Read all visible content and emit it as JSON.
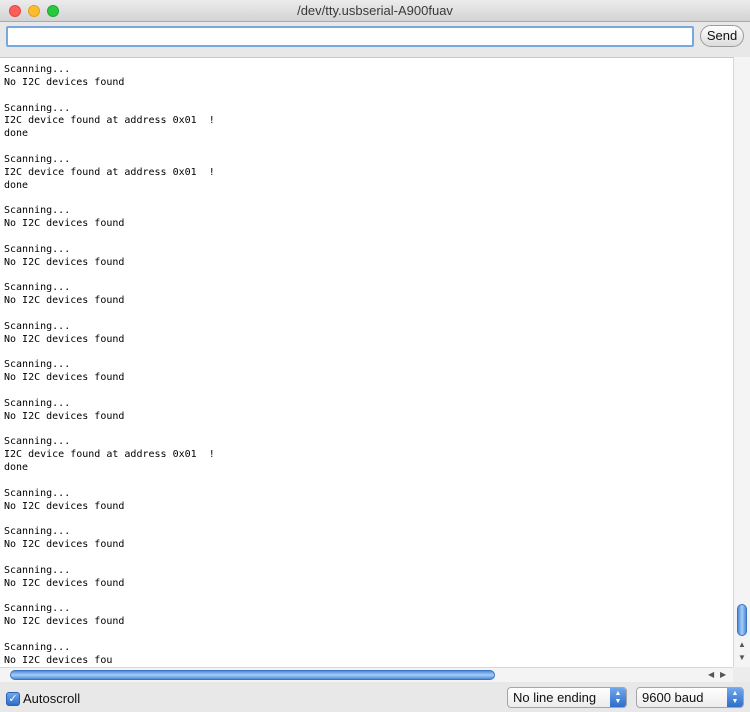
{
  "window": {
    "title": "/dev/tty.usbserial-A900fuav"
  },
  "toolbar": {
    "input_value": "",
    "send_label": "Send"
  },
  "console": {
    "lines": [
      "Scanning...",
      "No I2C devices found",
      "",
      "Scanning...",
      "I2C device found at address 0x01  !",
      "done",
      "",
      "Scanning...",
      "I2C device found at address 0x01  !",
      "done",
      "",
      "Scanning...",
      "No I2C devices found",
      "",
      "Scanning...",
      "No I2C devices found",
      "",
      "Scanning...",
      "No I2C devices found",
      "",
      "Scanning...",
      "No I2C devices found",
      "",
      "Scanning...",
      "No I2C devices found",
      "",
      "Scanning...",
      "No I2C devices found",
      "",
      "Scanning...",
      "I2C device found at address 0x01  !",
      "done",
      "",
      "Scanning...",
      "No I2C devices found",
      "",
      "Scanning...",
      "No I2C devices found",
      "",
      "Scanning...",
      "No I2C devices found",
      "",
      "Scanning...",
      "No I2C devices found",
      "",
      "Scanning...",
      "No I2C devices fou"
    ]
  },
  "statusbar": {
    "autoscroll_label": "Autoscroll",
    "autoscroll_checked": true,
    "line_ending": "No line ending",
    "baud": "9600 baud"
  },
  "colors": {
    "accent": "#4e8ce0",
    "input_focus": "#7aa7de"
  },
  "icons": {
    "checkbox": "checkmark-icon",
    "select": "updown-arrows-icon"
  }
}
